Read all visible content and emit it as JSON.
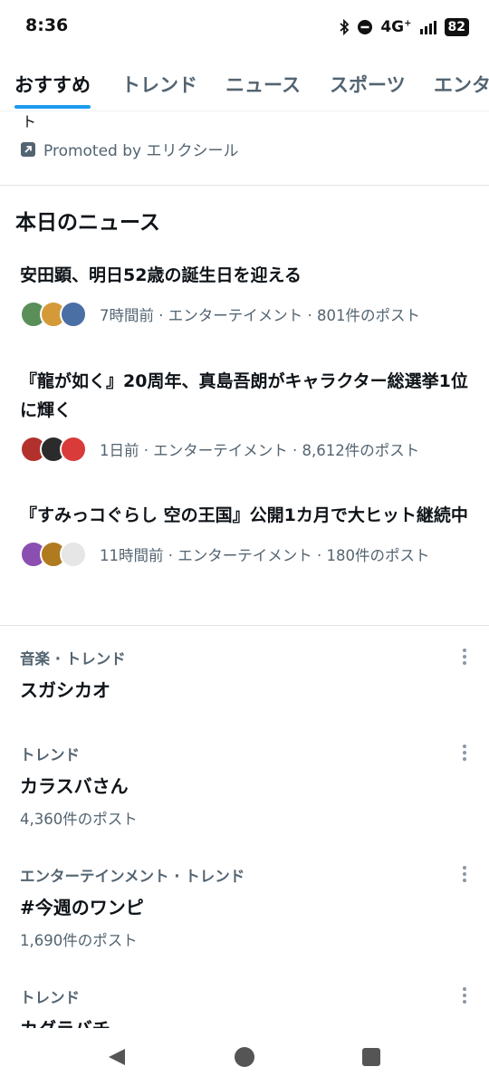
{
  "status": {
    "time": "8:36",
    "network": "4G",
    "network_plus": "+",
    "battery": "82"
  },
  "tabs": [
    "おすすめ",
    "トレンド",
    "ニュース",
    "スポーツ",
    "エンタ"
  ],
  "promo": {
    "partial_text": "ト",
    "promoted_label": "Promoted by エリクシール"
  },
  "news": {
    "section_title": "本日のニュース",
    "items": [
      {
        "title": "安田顕、明日52歳の誕生日を迎える",
        "meta": "7時間前 · エンターテイメント · 801件のポスト"
      },
      {
        "title": "『龍が如く』20周年、真島吾朗がキャラクター総選挙1位に輝く",
        "meta": "1日前 · エンターテイメント · 8,612件のポスト"
      },
      {
        "title": "『すみっコぐらし 空の王国』公開1カ月で大ヒット継続中",
        "meta": "11時間前 · エンターテイメント · 180件のポスト"
      }
    ]
  },
  "trends": [
    {
      "category": "音楽 · トレンド",
      "name": "スガシカオ",
      "count": ""
    },
    {
      "category": "トレンド",
      "name": "カラスバさん",
      "count": "4,360件のポスト"
    },
    {
      "category": "エンターテインメント · トレンド",
      "name": "#今週のワンピ",
      "count": "1,690件のポスト"
    },
    {
      "category": "トレンド",
      "name": "カグラバチ",
      "count": ""
    }
  ],
  "colors": {
    "accent": "#1d9bf0",
    "secondary_text": "#536471",
    "primary_text": "#0f1419"
  },
  "icons": {
    "promoted": "promoted-arrow-icon",
    "more": "more-vertical-icon",
    "nav": [
      "back-triangle-icon",
      "home-circle-icon",
      "recents-square-icon"
    ]
  }
}
